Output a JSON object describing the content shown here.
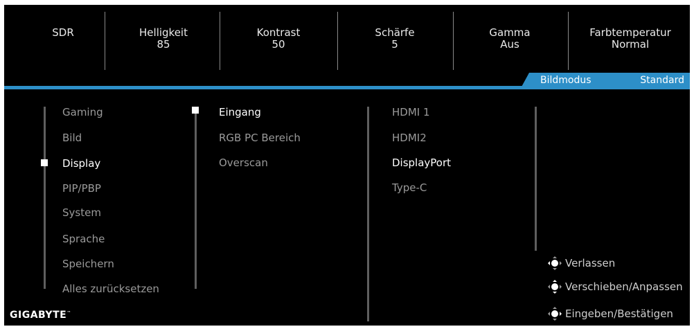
{
  "status": {
    "items": [
      {
        "label": "SDR",
        "value": ""
      },
      {
        "label": "Helligkeit",
        "value": "85"
      },
      {
        "label": "Kontrast",
        "value": "50"
      },
      {
        "label": "Schärfe",
        "value": "5"
      },
      {
        "label": "Gamma",
        "value": "Aus"
      },
      {
        "label": "Farbtemperatur",
        "value": "Normal"
      }
    ]
  },
  "mode": {
    "label": "Bildmodus",
    "value": "Standard"
  },
  "menu": {
    "main": [
      "Gaming",
      "Bild",
      "Display",
      "PIP/PBP",
      "System",
      "Sprache",
      "Speichern",
      "Alles zurücksetzen"
    ],
    "main_selected": "Display",
    "sub": [
      "Eingang",
      "RGB PC Bereich",
      "Overscan"
    ],
    "sub_selected": "Eingang",
    "options": [
      "HDMI 1",
      "HDMI2",
      "DisplayPort",
      "Type-C"
    ],
    "options_selected": "DisplayPort"
  },
  "hints": [
    {
      "icon": "joystick-left-icon",
      "label": "Verlassen"
    },
    {
      "icon": "joystick-move-icon",
      "label": "Verschieben/Anpassen"
    },
    {
      "icon": "joystick-press-icon",
      "label": "Eingeben/Bestätigen"
    }
  ],
  "brand": {
    "logo_text": "GIGABYTE",
    "trademark": "™"
  },
  "colors": {
    "accent": "#2d8fc8",
    "background": "#000000",
    "selected_text": "#ffffff",
    "inactive_text": "#9a9a9a"
  }
}
